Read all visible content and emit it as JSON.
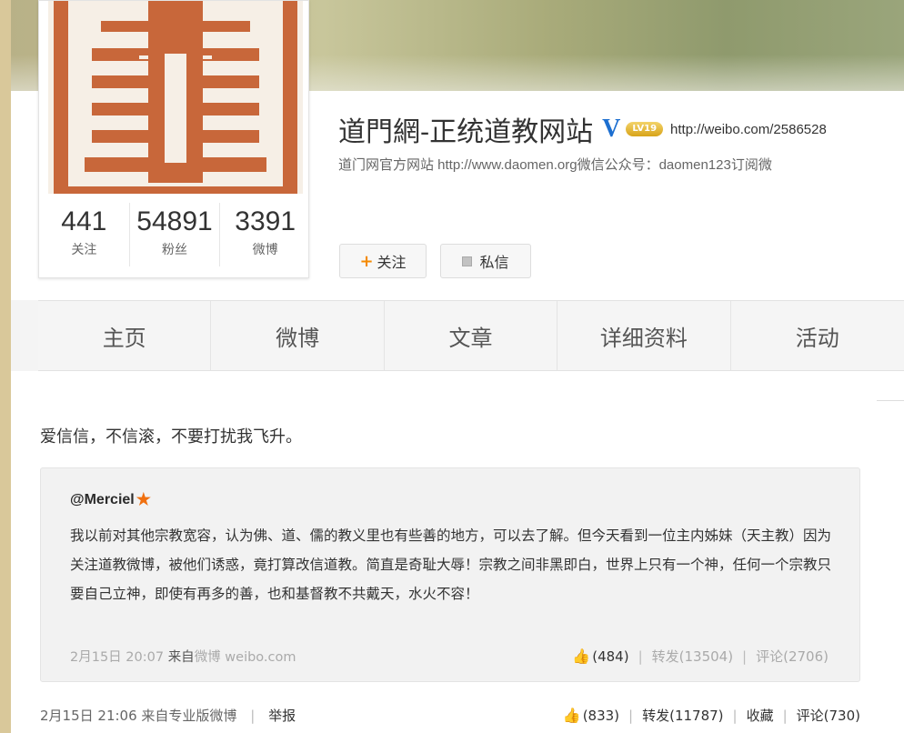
{
  "profile": {
    "name": "道門網-正统道教网站",
    "verified_mark": "V",
    "level_badge": "LV19",
    "url": "http://weibo.com/2586528",
    "description": "道门网官方网站 http://www.daomen.org微信公众号：daomen123订阅微",
    "stats": [
      {
        "value": "441",
        "label": "关注"
      },
      {
        "value": "54891",
        "label": "粉丝"
      },
      {
        "value": "3391",
        "label": "微博"
      }
    ],
    "follow_label": "关注",
    "message_label": "私信"
  },
  "tabs": [
    "主页",
    "微博",
    "文章",
    "详细资料",
    "活动"
  ],
  "post": {
    "text": "爱信信，不信滚，不要打扰我飞升。",
    "quote": {
      "author": "@Merciel",
      "body": "我以前对其他宗教宽容，认为佛、道、儒的教义里也有些善的地方，可以去了解。但今天看到一位主内姊妹（天主教）因为关注道教微博，被他们诱惑，竟打算改信道教。简直是奇耻大辱！宗教之间非黑即白，世界上只有一个神，任何一个宗教只要自己立神，即使有再多的善，也和基督教不共戴天，水火不容！",
      "time": "2月15日 20:07",
      "source_prefix": "来自",
      "source": "微博 weibo.com",
      "likes": "(484)",
      "reposts": "转发(13504)",
      "comments": "评论(2706)"
    },
    "time": "2月15日 21:06",
    "source": "来自专业版微博",
    "report": "举报",
    "likes": "(833)",
    "reposts": "转发(11787)",
    "favorite": "收藏",
    "comments": "评论(730)"
  },
  "colors": {
    "seal": "#c8673a",
    "verified": "#1d6fd0",
    "accent": "#f48a00"
  }
}
